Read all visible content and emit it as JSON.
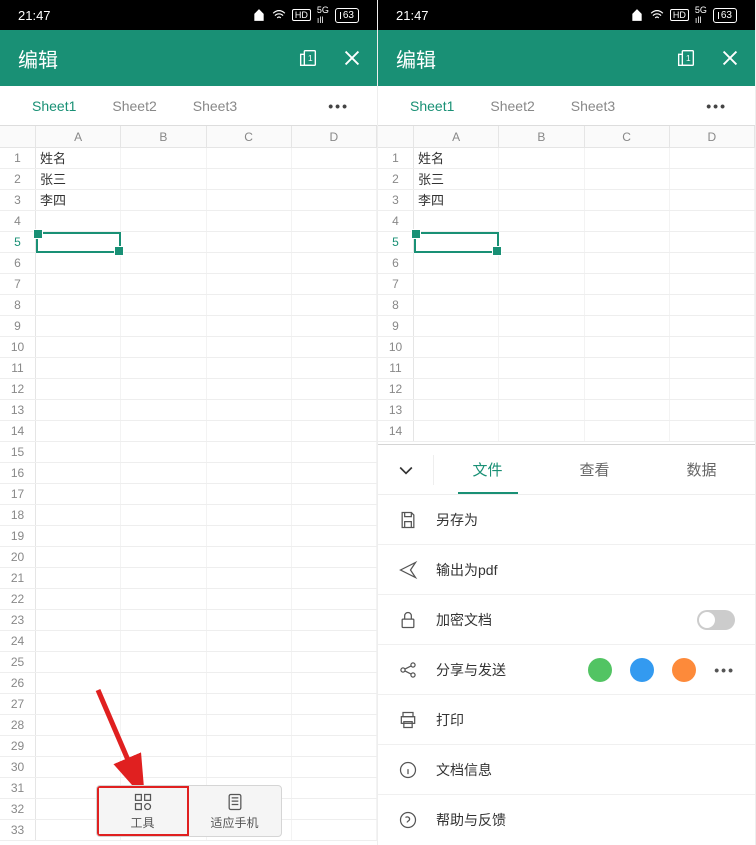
{
  "status": {
    "time": "21:47",
    "battery": "63"
  },
  "header": {
    "title": "编辑"
  },
  "sheets": {
    "s1": "Sheet1",
    "s2": "Sheet2",
    "s3": "Sheet3",
    "more": "•••"
  },
  "cols": {
    "a": "A",
    "b": "B",
    "c": "C",
    "d": "D"
  },
  "rows": {
    "data": [
      "姓名",
      "张三",
      "李四"
    ]
  },
  "selectedRow": "5",
  "bottom": {
    "tools": "工具",
    "mobile": "适应手机"
  },
  "toolTabs": {
    "file": "文件",
    "view": "查看",
    "data": "数据"
  },
  "menu": {
    "saveAs": "另存为",
    "pdf": "输出为pdf",
    "encrypt": "加密文档",
    "share": "分享与发送",
    "print": "打印",
    "docinfo": "文档信息",
    "help": "帮助与反馈"
  }
}
